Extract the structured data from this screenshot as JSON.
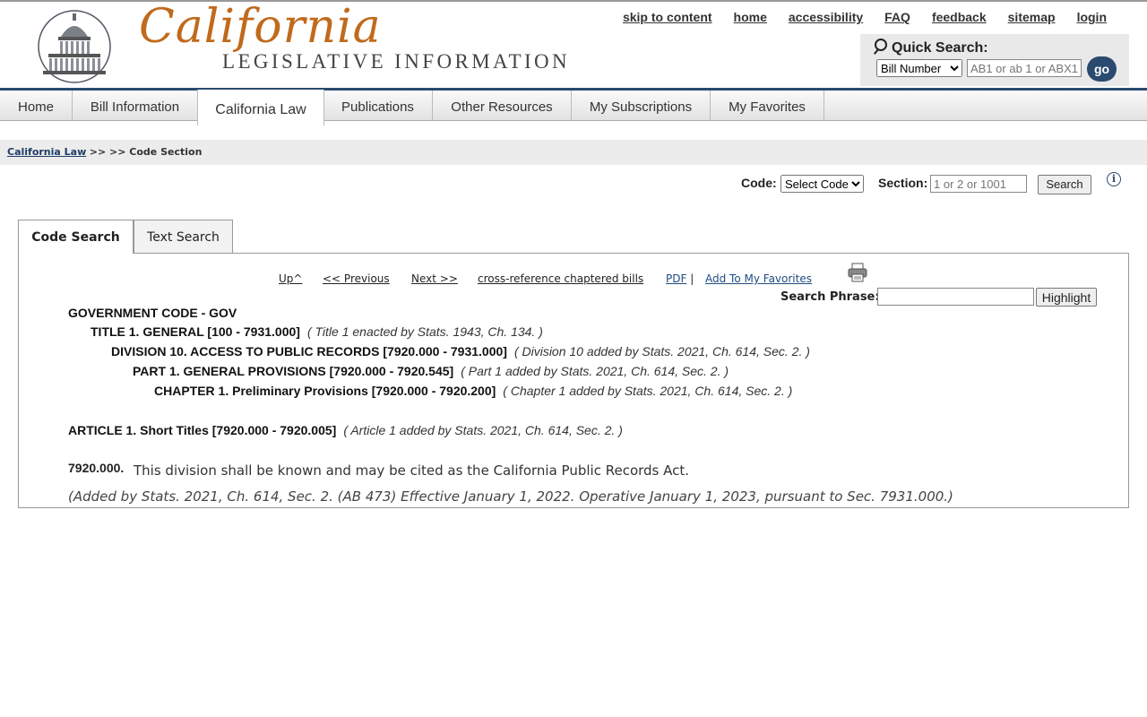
{
  "header": {
    "logo_script": "California",
    "logo_sub": "LEGISLATIVE INFORMATION",
    "util_links": [
      "skip to content",
      "home",
      "accessibility",
      "FAQ",
      "feedback",
      "sitemap",
      "login"
    ],
    "quick_search": {
      "title": "Quick Search:",
      "select_value": "Bill Number",
      "input_placeholder": "AB1 or ab 1 or ABX1",
      "go_label": "go"
    }
  },
  "nav": {
    "items": [
      "Home",
      "Bill Information",
      "California Law",
      "Publications",
      "Other Resources",
      "My Subscriptions",
      "My Favorites"
    ],
    "active": "California Law"
  },
  "breadcrumb": {
    "link": "California Law",
    "rest": ">> >> Code Section"
  },
  "code_search": {
    "code_label": "Code:",
    "code_select": "Select Code",
    "section_label": "Section:",
    "section_placeholder": "1 or 2 or 1001",
    "search_label": "Search",
    "info_icon": "info-icon"
  },
  "tabs": [
    "Code Search",
    "Text Search"
  ],
  "doc_links": {
    "up": "Up^",
    "previous": "<< Previous",
    "next": "Next >>",
    "crossref": "cross-reference chaptered bills",
    "pdf": "PDF",
    "sep": "|",
    "favorites": "Add To My Favorites",
    "printer_icon": "printer-icon"
  },
  "highlight": {
    "label": "Search Phrase:",
    "button": "Highlight"
  },
  "hierarchy": [
    {
      "title": "GOVERNMENT CODE - GOV",
      "note": ""
    },
    {
      "title": "TITLE 1. GENERAL [100 - 7931.000]",
      "note": "( Title 1 enacted by Stats. 1943, Ch. 134. )"
    },
    {
      "title": "DIVISION 10. ACCESS TO PUBLIC RECORDS [7920.000 - 7931.000]",
      "note": "( Division 10 added by Stats. 2021, Ch. 614, Sec. 2. )"
    },
    {
      "title": "PART 1. GENERAL PROVISIONS [7920.000 - 7920.545]",
      "note": "( Part 1 added by Stats. 2021, Ch. 614, Sec. 2. )"
    },
    {
      "title": "CHAPTER 1. Preliminary Provisions [7920.000 - 7920.200]",
      "note": "( Chapter 1 added by Stats. 2021, Ch. 614, Sec. 2. )"
    }
  ],
  "article": {
    "title": "ARTICLE 1. Short Titles [7920.000 - 7920.005]",
    "note": "( Article 1 added by Stats. 2021, Ch. 614, Sec. 2. )"
  },
  "section": {
    "number": "7920.000.",
    "text": "This division shall be known and may be cited as the California Public Records Act.",
    "history": "(Added by Stats. 2021, Ch. 614, Sec. 2. (AB 473) Effective January 1, 2022. Operative January 1, 2023, pursuant to Sec. 7931.000.)"
  }
}
